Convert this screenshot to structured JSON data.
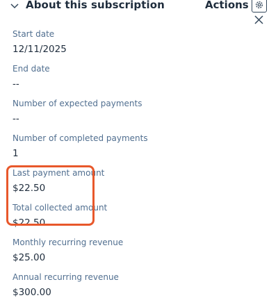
{
  "header": {
    "title": "About this subscription",
    "actions_label": "Actions",
    "collapse_icon": "chevron-down-icon",
    "settings_icon": "gear-icon",
    "close_icon": "close-icon"
  },
  "fields": [
    {
      "label": "Start date",
      "value": "12/11/2025"
    },
    {
      "label": "End date",
      "value": "--"
    },
    {
      "label": "Number of expected payments",
      "value": "--"
    },
    {
      "label": "Number of completed payments",
      "value": "1"
    },
    {
      "label": "Last payment amount",
      "value": "$22.50"
    },
    {
      "label": "Total collected amount",
      "value": "$22.50"
    },
    {
      "label": "Monthly recurring revenue",
      "value": "$25.00"
    },
    {
      "label": "Annual recurring revenue",
      "value": "$300.00"
    }
  ],
  "highlight_color": "#e8582b"
}
